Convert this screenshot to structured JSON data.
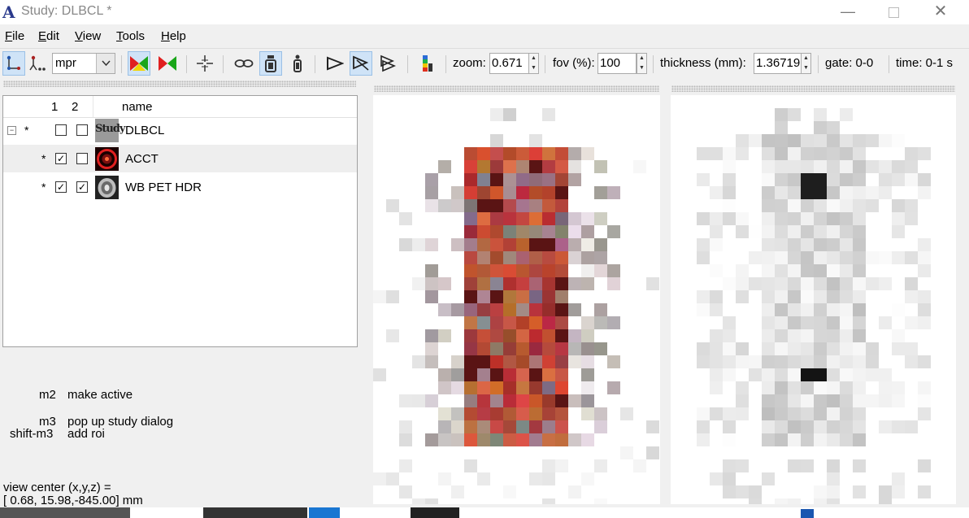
{
  "window": {
    "title": "Study: DLBCL *",
    "app_logo": "A"
  },
  "menu": [
    {
      "accel": "F",
      "rest": "ile"
    },
    {
      "accel": "E",
      "rest": "dit"
    },
    {
      "accel": "V",
      "rest": "iew"
    },
    {
      "accel": "T",
      "rest": "ools"
    },
    {
      "accel": "H",
      "rest": "elp"
    }
  ],
  "toolbar": {
    "view_mode": "mpr",
    "zoom_label": "zoom:",
    "zoom_value": "0.671",
    "fov_label": "fov (%):",
    "fov_value": "100",
    "thickness_label": "thickness (mm):",
    "thickness_value": "1.36719",
    "gate_label": "gate: 0-0",
    "time_label": "time: 0-1 s",
    "icons": [
      "transverse-view-icon",
      "coronal-view-icon",
      "fusion-blend-icon",
      "fusion-overlay-icon",
      "crosshair-icon",
      "link-icon",
      "view-mode-single-icon",
      "view-mode-linked-icon",
      "line-profile-icon",
      "target-active-icon",
      "target-all-icon",
      "colormap-icon"
    ]
  },
  "tree": {
    "headers": {
      "col1": "1",
      "col2": "2",
      "name": "name"
    },
    "rows": [
      {
        "star": "*",
        "name": "DLBCL",
        "thumb": "study-icon",
        "thumb_text": "Study",
        "check1": false,
        "check2": false
      },
      {
        "star": "*",
        "name": "ACCT",
        "thumb": "ct-thumbnail-icon",
        "check1": true,
        "check2": false
      },
      {
        "star": "*",
        "name": "WB PET HDR",
        "thumb": "pet-thumbnail-icon",
        "check1": true,
        "check2": true
      }
    ]
  },
  "help": [
    {
      "key": "m2",
      "action": "make active"
    },
    {
      "key": "m3",
      "action": "pop up study dialog"
    },
    {
      "key": "shift-m3",
      "action": "add roi"
    }
  ],
  "status": {
    "label": "view center (x,y,z) =",
    "value": "[ 0.68, 15.98,-845.00] mm"
  },
  "colors": {
    "accent_selected": "#cfe3f7",
    "logo": "#2a3a8c",
    "fusion_red": "#e02020",
    "fusion_green": "#19a619",
    "fusion_yellow": "#f2d500"
  }
}
